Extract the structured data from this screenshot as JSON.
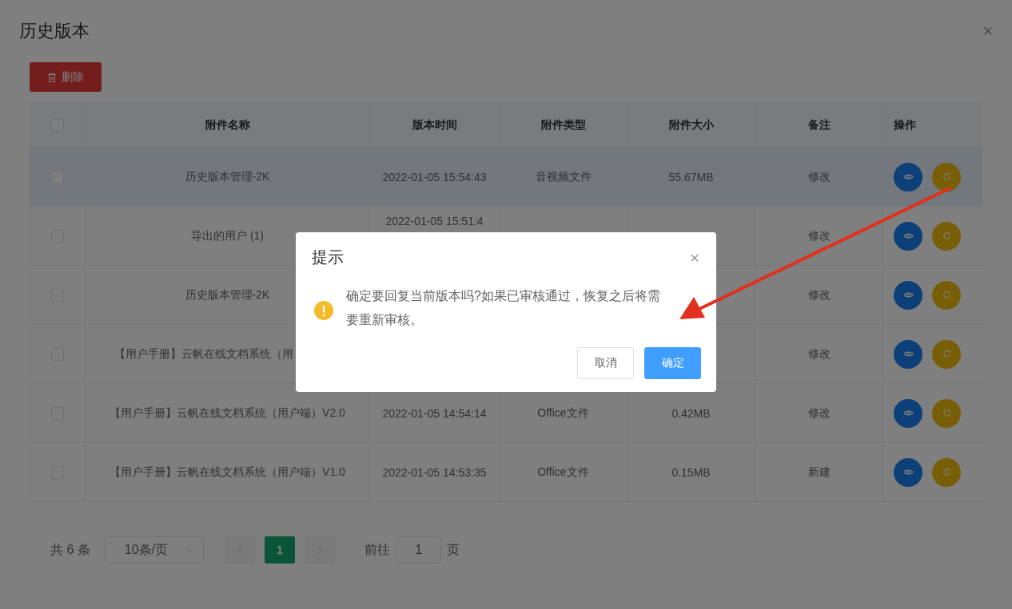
{
  "dialog": {
    "title": "历史版本",
    "close": "×",
    "delete_button": "删除"
  },
  "table": {
    "columns": [
      "附件名称",
      "版本时间",
      "附件类型",
      "附件大小",
      "备注",
      "操作"
    ],
    "header_checked": false,
    "rows": [
      {
        "selected": true,
        "checked": false,
        "name": "历史版本管理-2K",
        "time": "2022-01-05 15:54:43",
        "type": "音视频文件",
        "size": "55.67MB",
        "note": "修改"
      },
      {
        "selected": false,
        "checked": false,
        "name": "导出的用户 (1)",
        "time": "2022-01-05 15:51:4",
        "note": "修改",
        "cut_time": true
      },
      {
        "selected": false,
        "checked": false,
        "name": "历史版本管理-2K",
        "note": "修改"
      },
      {
        "selected": false,
        "checked": false,
        "name": "【用户手册】云帆在线文档系统（用",
        "note": "修改",
        "cut_name": true
      },
      {
        "selected": false,
        "checked": false,
        "name": "【用户手册】云帆在线文档系统（用户端）V2.0",
        "time": "2022-01-05 14:54:14",
        "type": "Office文件",
        "size": "0.42MB",
        "note": "修改"
      },
      {
        "selected": false,
        "checked": false,
        "name": "【用户手册】云帆在线文档系统（用户端）V1.0",
        "time": "2022-01-05 14:53:35",
        "type": "Office文件",
        "size": "0.15MB",
        "note": "新建"
      }
    ]
  },
  "pagination": {
    "total": "共 6 条",
    "page_size": "10条/页",
    "pages": [
      {
        "label": "1",
        "selected": true
      }
    ],
    "goto_label": "前往",
    "goto_value": "1",
    "goto_suffix": "页"
  },
  "modal": {
    "title": "提示",
    "close": "×",
    "message": "确定要回复当前版本吗?如果已审核通过，恢复之后将需要重新审核。",
    "buttons": [
      {
        "label": "取消",
        "kind": "plain"
      },
      {
        "label": "确定",
        "kind": "primary"
      }
    ]
  }
}
